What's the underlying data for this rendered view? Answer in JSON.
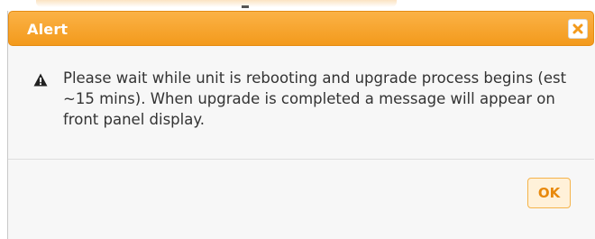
{
  "dialog": {
    "title": "Alert",
    "close_icon": "close-icon",
    "warning_icon": "warning-icon",
    "message": "Please wait while unit is rebooting and upgrade process begins (est ~15 mins). When upgrade is completed a message will appear on front panel display.",
    "ok_label": "OK"
  },
  "colors": {
    "titlebar": "#f7a12a",
    "title_text": "#ffffff",
    "close_x": "#f39a1c",
    "ok_text": "#e8890c",
    "ok_border": "#f5b34a",
    "ok_background": "#fff1d9",
    "body_background": "#f7f7f7",
    "message_text": "#333333"
  }
}
